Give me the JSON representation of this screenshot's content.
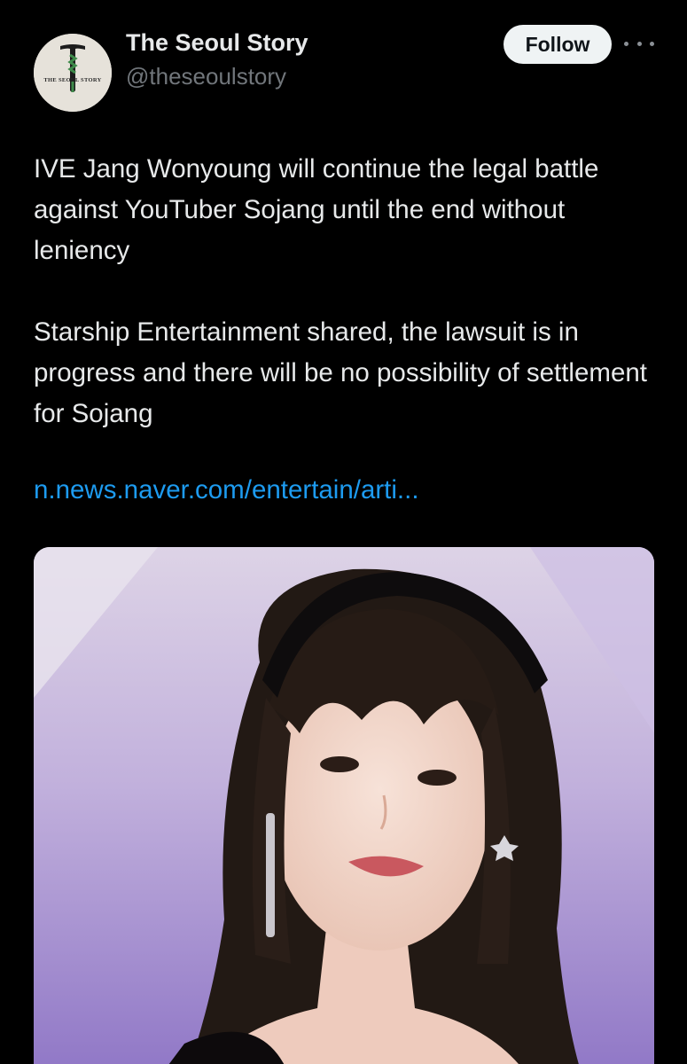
{
  "account": {
    "display_name": "The Seoul Story",
    "handle": "@theseoulstory",
    "avatar_text": "THE SEOUL STORY"
  },
  "actions": {
    "follow_label": "Follow",
    "more_icon": "more-horizontal-icon"
  },
  "tweet": {
    "paragraphs": [
      "IVE Jang Wonyoung will continue the legal battle against YouTuber Sojang until the end without leniency",
      "Starship Entertainment shared, the lawsuit is in progress and there will be no possibility of settlement for Sojang"
    ],
    "link": "n.news.naver.com/entertain/arti..."
  },
  "colors": {
    "background": "#000000",
    "text": "#e7e9ea",
    "secondary": "#71767b",
    "link": "#1d9bf0",
    "follow_bg": "#eff3f4"
  }
}
